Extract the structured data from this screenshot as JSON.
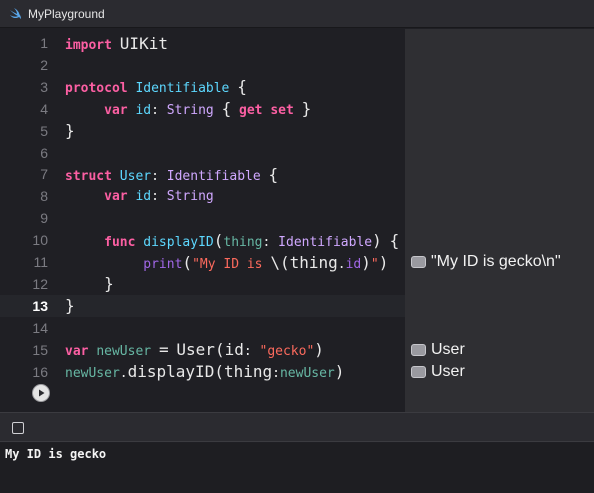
{
  "window": {
    "title": "MyPlayground",
    "icon": "swift-icon"
  },
  "editor": {
    "current_line": 13,
    "lines": [
      {
        "num": "1",
        "tokens": [
          [
            "import",
            "kw"
          ],
          [
            " ",
            "plain"
          ],
          [
            "UIKit",
            "plain big"
          ]
        ]
      },
      {
        "num": "2",
        "tokens": []
      },
      {
        "num": "3",
        "tokens": [
          [
            "protocol",
            "kw"
          ],
          [
            " ",
            "plain"
          ],
          [
            "Identifiable",
            "type"
          ],
          [
            " ",
            "plain"
          ],
          [
            "{",
            "plain big"
          ]
        ]
      },
      {
        "num": "4",
        "tokens": [
          [
            "     ",
            "plain"
          ],
          [
            "var",
            "kw"
          ],
          [
            " ",
            "plain"
          ],
          [
            "id",
            "type"
          ],
          [
            ": ",
            "plain"
          ],
          [
            "String",
            "typeuse"
          ],
          [
            " ",
            "plain"
          ],
          [
            "{",
            "plain big"
          ],
          [
            " ",
            "plain"
          ],
          [
            "get",
            "kw"
          ],
          [
            " ",
            "plain"
          ],
          [
            "set",
            "kw"
          ],
          [
            " ",
            "plain"
          ],
          [
            "}",
            "plain big"
          ]
        ]
      },
      {
        "num": "5",
        "tokens": [
          [
            "}",
            "plain big"
          ]
        ]
      },
      {
        "num": "6",
        "tokens": []
      },
      {
        "num": "7",
        "tokens": [
          [
            "struct",
            "kw"
          ],
          [
            " ",
            "plain"
          ],
          [
            "User",
            "type"
          ],
          [
            ": ",
            "plain"
          ],
          [
            "Identifiable",
            "typeuse"
          ],
          [
            " ",
            "plain"
          ],
          [
            "{",
            "plain big"
          ]
        ]
      },
      {
        "num": "8",
        "tokens": [
          [
            "     ",
            "plain"
          ],
          [
            "var",
            "kw"
          ],
          [
            " ",
            "plain"
          ],
          [
            "id",
            "type"
          ],
          [
            ": ",
            "plain"
          ],
          [
            "String",
            "typeuse"
          ]
        ]
      },
      {
        "num": "9",
        "tokens": []
      },
      {
        "num": "10",
        "tokens": [
          [
            "     ",
            "plain"
          ],
          [
            "func",
            "kw"
          ],
          [
            " ",
            "plain"
          ],
          [
            "displayID",
            "type"
          ],
          [
            "(",
            "plain big"
          ],
          [
            "thing",
            "name"
          ],
          [
            ": ",
            "plain"
          ],
          [
            "Identifiable",
            "typeuse"
          ],
          [
            ")",
            "plain big"
          ],
          [
            " ",
            "plain"
          ],
          [
            "{",
            "plain big"
          ]
        ]
      },
      {
        "num": "11",
        "tokens": [
          [
            "          ",
            "plain"
          ],
          [
            "print",
            "fn"
          ],
          [
            "(",
            "plain big"
          ],
          [
            "\"My ID is ",
            "str"
          ],
          [
            "\\(",
            "plain big"
          ],
          [
            "thing",
            "plain big"
          ],
          [
            ".",
            "plain"
          ],
          [
            "id",
            "fn"
          ],
          [
            ")",
            "plain big"
          ],
          [
            "\"",
            "str"
          ],
          [
            ")",
            "plain big"
          ]
        ]
      },
      {
        "num": "12",
        "tokens": [
          [
            "     ",
            "plain"
          ],
          [
            "}",
            "plain big"
          ]
        ]
      },
      {
        "num": "13",
        "tokens": [
          [
            "}",
            "plain big"
          ]
        ]
      },
      {
        "num": "14",
        "tokens": []
      },
      {
        "num": "15",
        "tokens": [
          [
            "var",
            "kw"
          ],
          [
            " ",
            "plain"
          ],
          [
            "newUser",
            "name"
          ],
          [
            " ",
            "plain"
          ],
          [
            "=",
            "plain big"
          ],
          [
            " ",
            "plain"
          ],
          [
            "User",
            "plain big"
          ],
          [
            "(",
            "plain big"
          ],
          [
            "id",
            "plain big"
          ],
          [
            ": ",
            "plain"
          ],
          [
            "\"gecko\"",
            "str"
          ],
          [
            ")",
            "plain big"
          ]
        ]
      },
      {
        "num": "16",
        "tokens": [
          [
            "newUser",
            "name"
          ],
          [
            ".",
            "plain"
          ],
          [
            "displayID",
            "plain big"
          ],
          [
            "(",
            "plain big"
          ],
          [
            "thing",
            "plain big"
          ],
          [
            ":",
            "plain"
          ],
          [
            "newUser",
            "name"
          ],
          [
            ")",
            "plain big"
          ]
        ]
      }
    ]
  },
  "results": [
    {
      "line": 11,
      "text": "\"My ID is gecko\\n\""
    },
    {
      "line": 15,
      "text": "User"
    },
    {
      "line": 16,
      "text": "User"
    }
  ],
  "run_button": {
    "icon": "play-icon"
  },
  "debug_bar": {
    "toggle_icon": "show-debug-area-icon"
  },
  "console": {
    "output": "My ID is gecko"
  }
}
